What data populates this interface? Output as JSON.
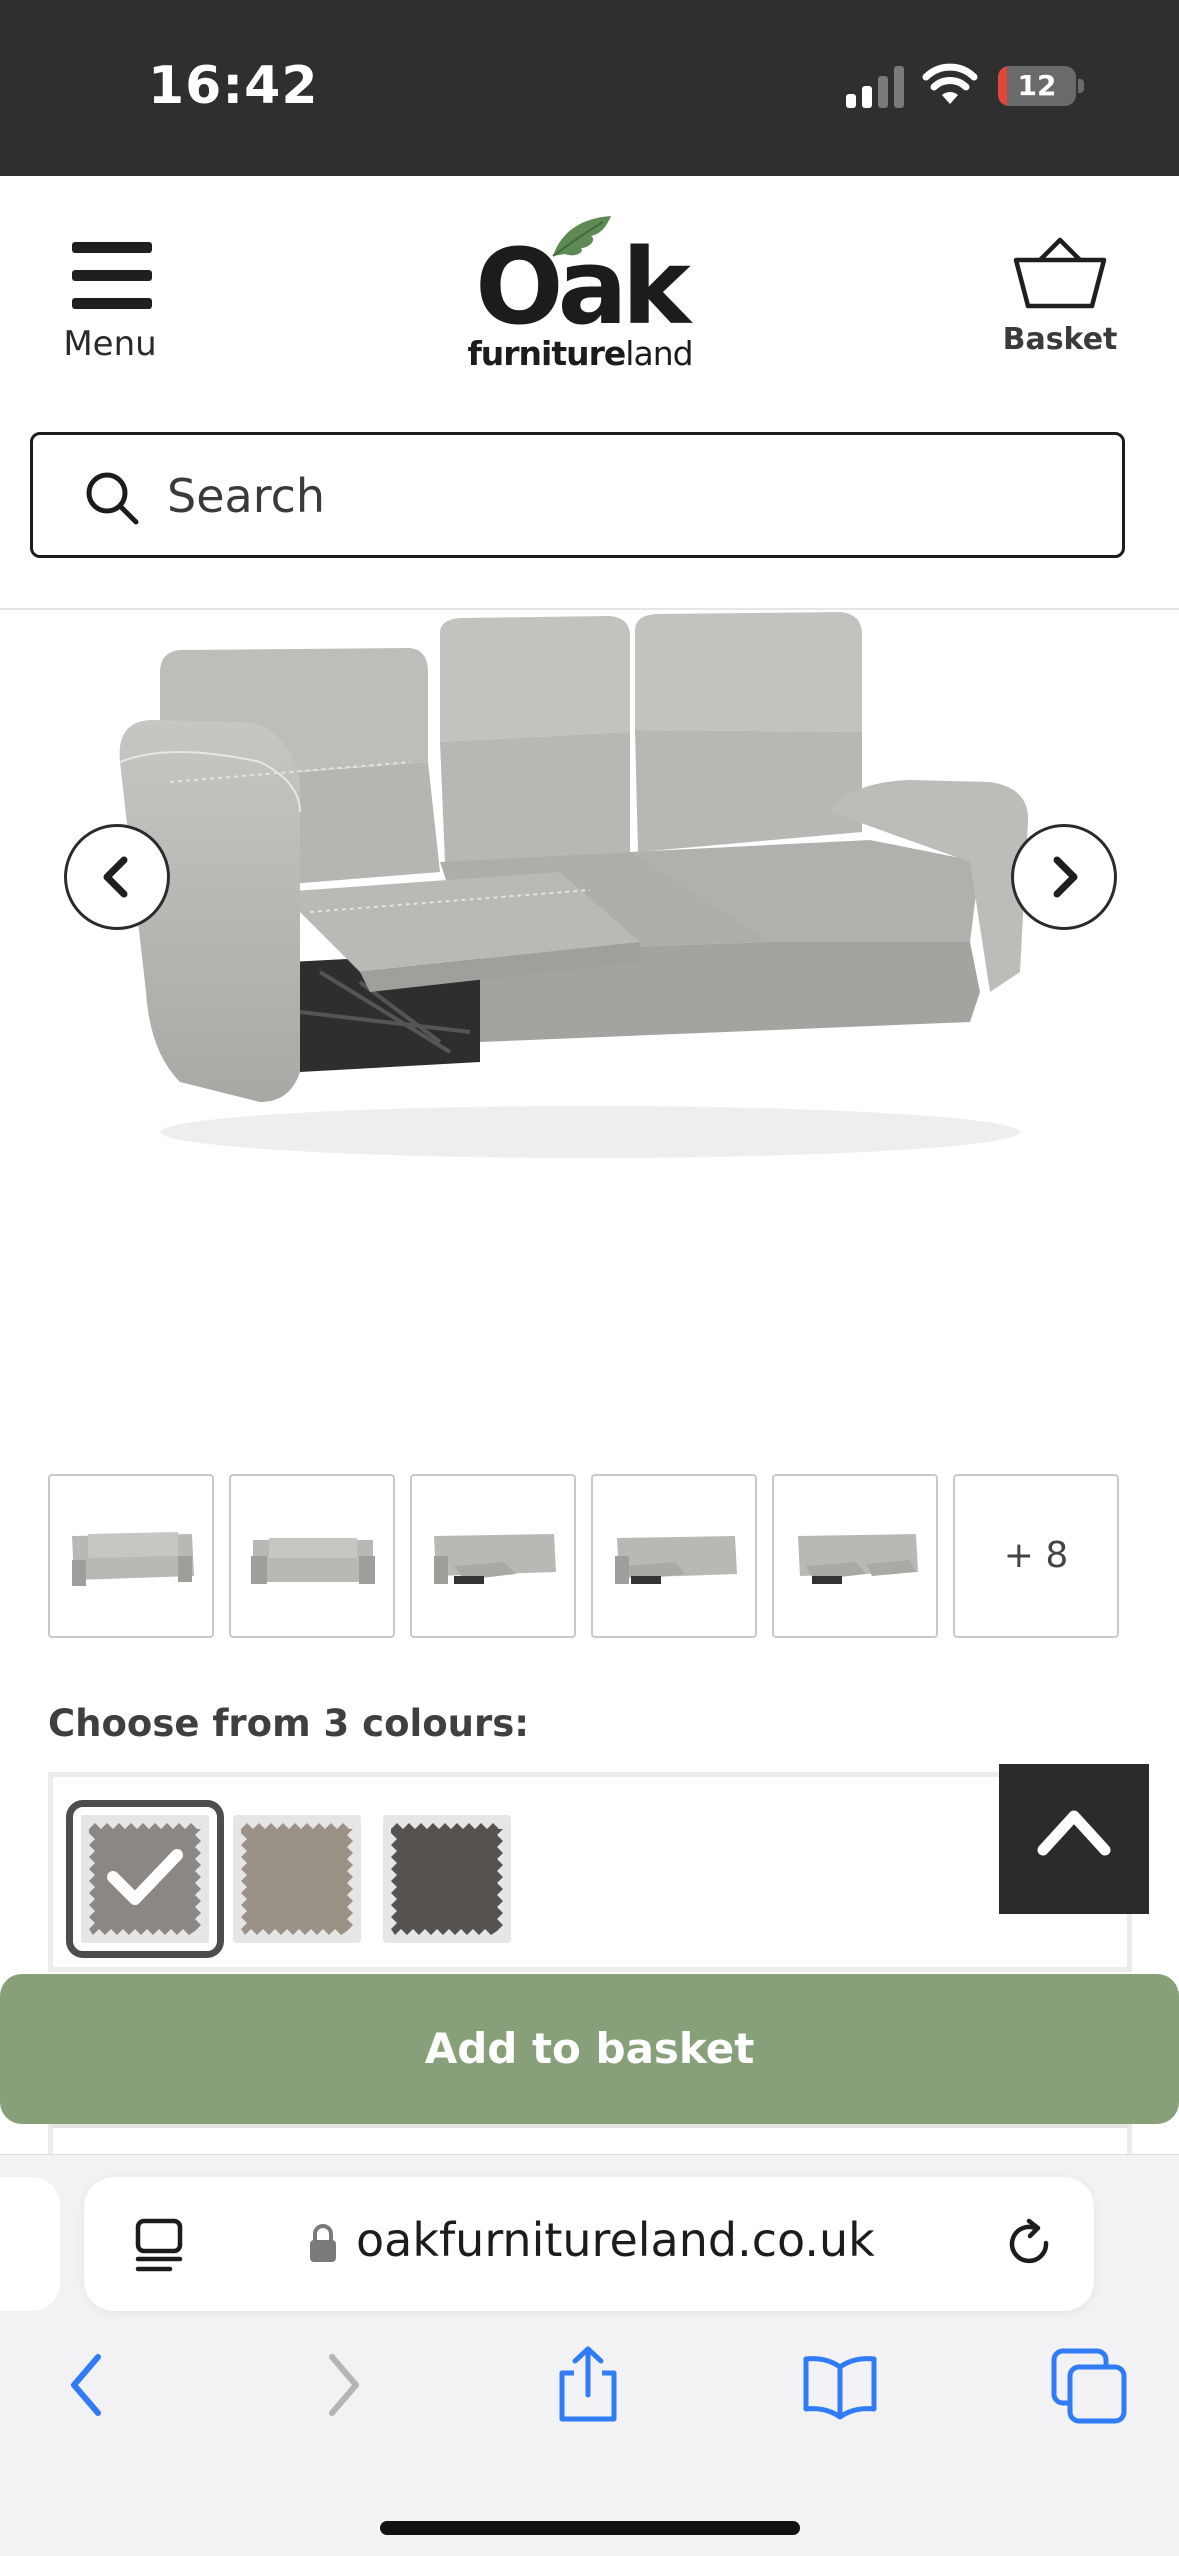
{
  "status_bar": {
    "time": "16:42",
    "battery": "12",
    "battery_level": 0.12
  },
  "header": {
    "menu_label": "Menu",
    "logo_main": "Oak",
    "logo_sub_bold": "furniture",
    "logo_sub_light": "land",
    "basket_label": "Basket",
    "search_placeholder": "Search"
  },
  "gallery": {
    "thumbnails": [
      "sofa-front",
      "sofa-front-upright",
      "sofa-recline-left",
      "sofa-recline-right",
      "sofa-recline-both"
    ],
    "more_label": "+ 8"
  },
  "colours": {
    "title": "Choose from 3 colours:",
    "swatches": [
      {
        "color": "#8c8782",
        "selected": true
      },
      {
        "color": "#9a9187",
        "selected": false
      },
      {
        "color": "#56524f",
        "selected": false
      }
    ]
  },
  "actions": {
    "add_to_basket": "Add to basket"
  },
  "browser": {
    "url": "oakfurnitureland.co.uk"
  },
  "colors": {
    "accent_green": "#87a07a",
    "status_bar": "#2f2f2f",
    "link_blue": "#2f7cf6"
  }
}
